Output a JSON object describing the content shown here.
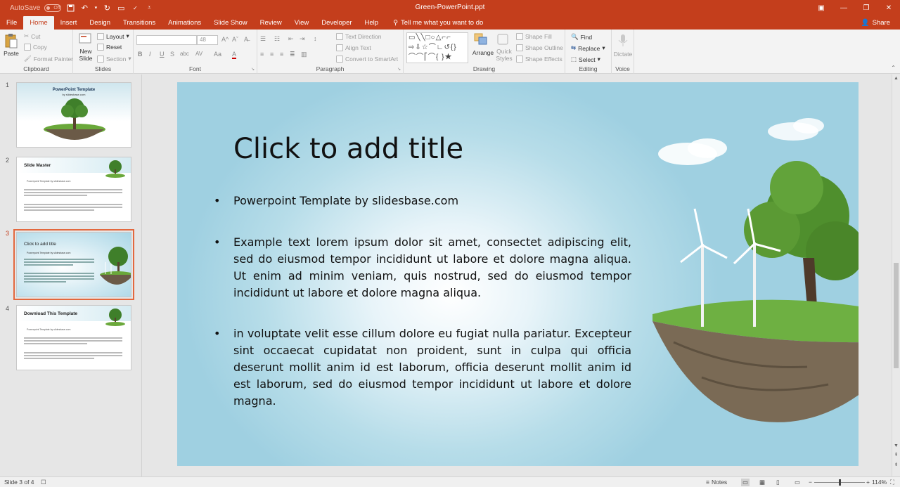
{
  "titlebar": {
    "autosave_label": "AutoSave",
    "autosave_state": "Off",
    "document_title": "Green-PowerPoint.ppt"
  },
  "tabs": [
    {
      "label": "File"
    },
    {
      "label": "Home"
    },
    {
      "label": "Insert"
    },
    {
      "label": "Design"
    },
    {
      "label": "Transitions"
    },
    {
      "label": "Animations"
    },
    {
      "label": "Slide Show"
    },
    {
      "label": "Review"
    },
    {
      "label": "View"
    },
    {
      "label": "Developer"
    },
    {
      "label": "Help"
    }
  ],
  "active_tab": "Home",
  "tellme": "Tell me what you want to do",
  "share": "Share",
  "ribbon": {
    "clipboard": {
      "paste": "Paste",
      "cut": "Cut",
      "copy": "Copy",
      "format_painter": "Format Painter",
      "label": "Clipboard"
    },
    "slides": {
      "new_slide": "New",
      "new_slide2": "Slide",
      "layout": "Layout",
      "reset": "Reset",
      "section": "Section",
      "label": "Slides"
    },
    "font": {
      "size": "48",
      "label": "Font",
      "bold": "B",
      "italic": "I",
      "underline": "U",
      "strike": "S",
      "shadow": "abc",
      "spacing": "AV",
      "case": "Aa",
      "color": "A"
    },
    "paragraph": {
      "text_direction": "Text Direction",
      "align_text": "Align Text",
      "smartart": "Convert to SmartArt",
      "label": "Paragraph"
    },
    "drawing": {
      "arrange": "Arrange",
      "quick_styles": "Quick",
      "quick_styles2": "Styles",
      "shape_fill": "Shape Fill",
      "shape_outline": "Shape Outline",
      "shape_effects": "Shape Effects",
      "label": "Drawing"
    },
    "editing": {
      "find": "Find",
      "replace": "Replace",
      "select": "Select",
      "label": "Editing"
    },
    "voice": {
      "dictate": "Dictate",
      "label": "Voice"
    }
  },
  "thumbnails": [
    {
      "num": "1",
      "title": "PowerPoint Template",
      "subtitle": "by slidesbase.com"
    },
    {
      "num": "2",
      "title": "Slide Master",
      "line1": "Powerpoint Template by slidesbase.com"
    },
    {
      "num": "3",
      "title": "Click to add title",
      "line1": "Powerpoint Template by slidesbase.com"
    },
    {
      "num": "4",
      "title": "Download This Template",
      "line1": "Powerpoint Template by slidesbase.com"
    }
  ],
  "selected_slide": 3,
  "slide": {
    "title": "Click to add title",
    "bullets": [
      "Powerpoint Template by slidesbase.com",
      "Example text lorem ipsum dolor sit amet, consectet adipiscing elit, sed do eiusmod tempor incididunt ut labore et dolore magna aliqua. Ut enim ad minim veniam, quis nostrud, sed do eiusmod tempor incididunt ut labore et dolore magna aliqua.",
      "in voluptate velit esse cillum dolore eu fugiat nulla pariatur. Excepteur sint occaecat cupidatat non proident, sunt in culpa qui officia deserunt mollit anim id est laborum, officia deserunt mollit anim id est laborum, sed do eiusmod tempor incididunt ut labore et dolore magna."
    ]
  },
  "statusbar": {
    "slide_info": "Slide 3 of 4",
    "notes": "Notes",
    "zoom": "114%"
  },
  "colors": {
    "accent": "#c43e1c",
    "ribbon_bg": "#f3f3f3",
    "slide_bg": "#9fd0e1"
  }
}
